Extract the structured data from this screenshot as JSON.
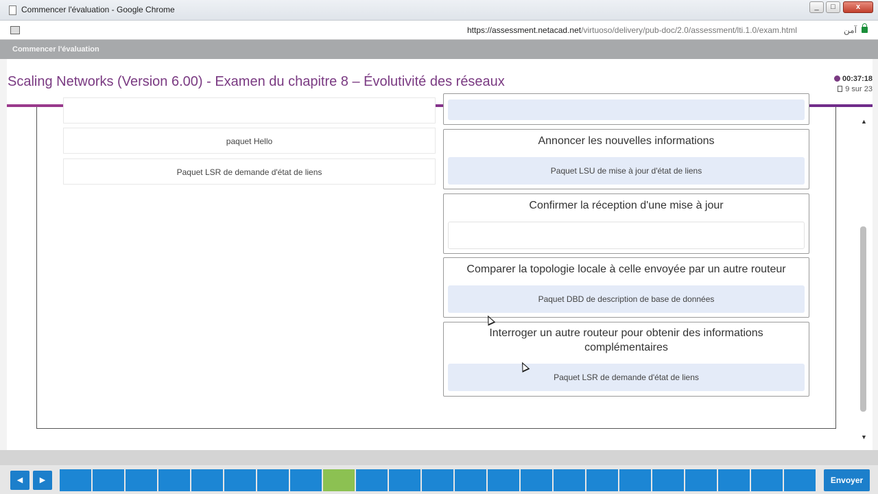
{
  "window": {
    "title": "Commencer l'évaluation - Google Chrome",
    "controls": [
      "_",
      "□",
      "x"
    ]
  },
  "address_bar": {
    "url_host": "https://assessment.netacad.net",
    "url_path": "/virtuoso/delivery/pub-doc/2.0/assessment/lti.1.0/exam.html",
    "security_label": "آمن"
  },
  "app": {
    "title": "Commencer l'évaluation"
  },
  "exam": {
    "title": "Scaling Networks (Version 6.00) - Examen du chapitre 8 – Évolutivité des réseaux",
    "timer": "00:37:18",
    "progress": "9 sur 23"
  },
  "question": {
    "source_items": [
      {
        "label": ""
      },
      {
        "label": "paquet Hello"
      },
      {
        "label": "Paquet LSR de demande d'état de liens"
      }
    ],
    "targets": [
      {
        "description": "",
        "answer": ""
      },
      {
        "description": "Annoncer les nouvelles informations",
        "answer": "Paquet LSU de mise à jour d'état de liens"
      },
      {
        "description": "Confirmer la réception d'une mise à jour",
        "answer": ""
      },
      {
        "description": "Comparer la topologie locale à celle envoyée par un autre routeur",
        "answer": "Paquet DBD de description de base de données"
      },
      {
        "description": "Interroger un autre routeur pour obtenir des informations complémentaires",
        "answer": "Paquet LSR de demande d'état de liens"
      }
    ]
  },
  "navigation": {
    "prev_glyph": "◀",
    "next_glyph": "▶",
    "question_count": 23,
    "current_question": 9,
    "submit_label": "Envoyer"
  },
  "colors": {
    "accent_purple": "#7a3a82",
    "nav_blue": "#1c86d4",
    "current_green": "#8cc152",
    "answer_fill": "#e4ebf8"
  }
}
